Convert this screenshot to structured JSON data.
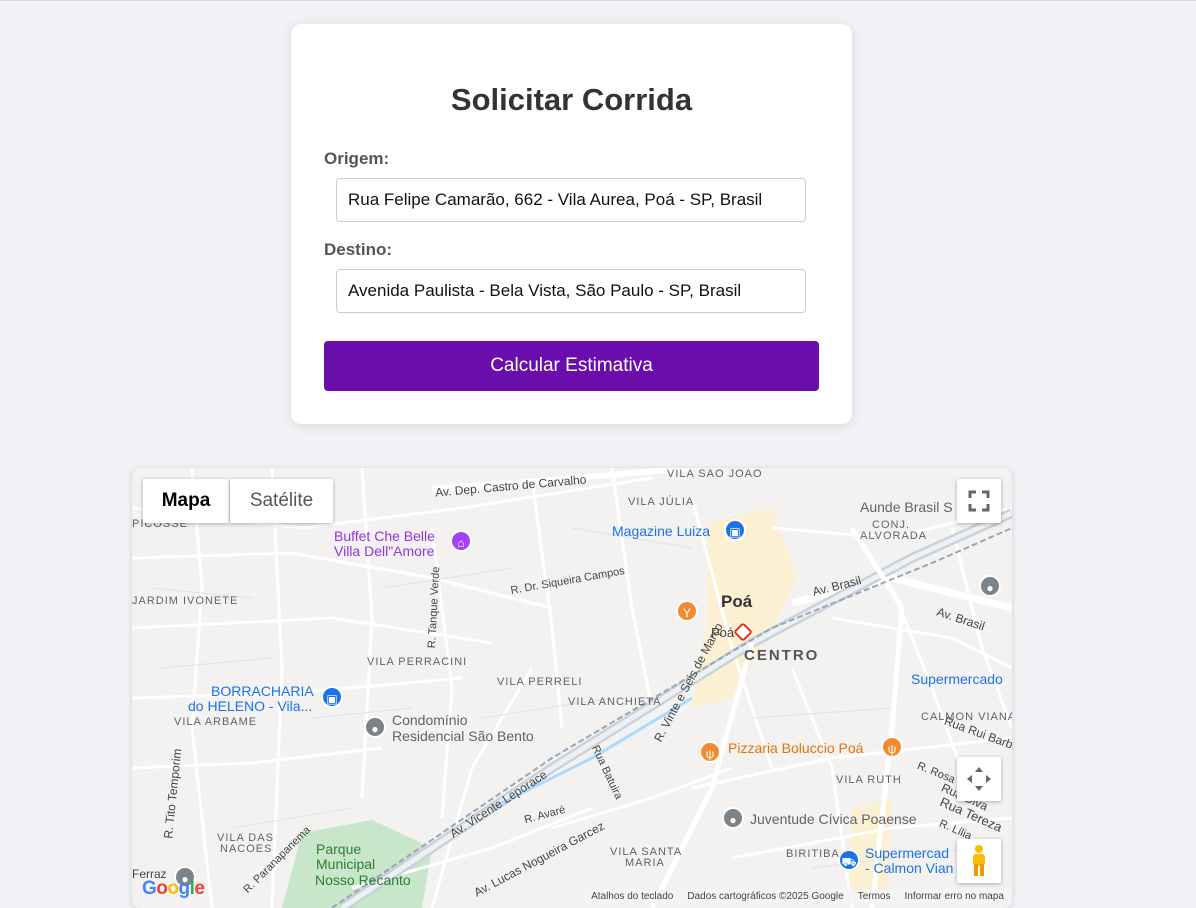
{
  "form": {
    "title": "Solicitar Corrida",
    "origin_label": "Origem:",
    "origin_value": "Rua Felipe Camarão, 662 - Vila Aurea, Poá - SP, Brasil",
    "destination_label": "Destino:",
    "destination_value": "Avenida Paulista - Bela Vista, São Paulo - SP, Brasil",
    "submit_label": "Calcular Estimativa",
    "accent_color": "#6a0dad"
  },
  "map": {
    "map_type_buttons": [
      "Mapa",
      "Satélite"
    ],
    "selected_map_type": "Mapa",
    "fullscreen_icon": "fullscreen-icon",
    "camera_icon": "camera-control-icon",
    "pegman_icon": "pegman-icon",
    "logo": "Google",
    "attribution": {
      "shortcuts": "Atalhos do teclado",
      "data": "Dados cartográficos ©2025 Google",
      "terms": "Termos",
      "report": "Informar erro no mapa"
    },
    "areas": {
      "vila_sao_joao": "VILA SAO JOAO",
      "vila_julia": "VILA JÚLIA",
      "conj_alvorada_1": "CONJ.",
      "conj_alvorada_2": "ALVORADA",
      "jardim_ivonete": "JARDIM IVONETE",
      "vila_perracini": "VILA PERRACINI",
      "vila_perreli": "VILA PERRELI",
      "vila_anchieta": "VILA ANCHIETA",
      "vila_arbame": "VILA ARBAME",
      "calmon_viana": "CALMON VIANA",
      "vila_ruth": "VILA RUTH",
      "vila_das_nacoes_1": "VILA DAS",
      "vila_das_nacoes_2": "NACOES",
      "vila_santa_maria_1": "VILA SANTA",
      "vila_santa_maria_2": "MARIA",
      "biritiba": "BIRITIBA",
      "centro": "CENTRO",
      "poa": "Poá",
      "picosse": "PICOSSE"
    },
    "streets": {
      "castro_carvalho": "Av. Dep. Castro de Carvalho",
      "siqueira_campos": "R. Dr. Siqueira Campos",
      "av_brasil": "Av. Brasil",
      "tanque_verde": "R. Tanque Verde",
      "vicente_leporace": "Av. Vicente Leporace",
      "vinte_seis_marco": "R. Vinte e Seis de Março",
      "batuira": "Rua Batuira",
      "tito_temporim": "R. Tito Temporim",
      "avare": "R. Avaré",
      "lucas_garcez": "Av. Lucas Nogueira Garcez",
      "paranapanema": "R. Paranapanema",
      "rui_barbosa": "Rua Rui Barbosa",
      "rua_diva": "Rua Diva",
      "rua_tereza": "Rua Tereza",
      "r_lilia": "R. Lília",
      "r_rosa": "R. Rosa"
    },
    "places": {
      "buffet_1": "Buffet Che Belle",
      "buffet_2": "Villa Dell\"Amore",
      "magazine_luiza": "Magazine Luiza",
      "aunde": "Aunde Brasil S",
      "poa_station": "Poá",
      "borracharia_1": "BORRACHARIA",
      "borracharia_2": "do HELENO - Vila...",
      "condominio_1": "Condomínio",
      "condominio_2": "Residencial São Bento",
      "supermercado": "Supermercado",
      "pizzaria": "Pizzaria Boluccio Poá",
      "juventude": "Juventude Cívica Poaense",
      "super_calmon_1": "Supermercad",
      "super_calmon_2": "- Calmon Vian",
      "parque_1": "Parque",
      "parque_2": "Municipal",
      "parque_3": "Nosso Recanto",
      "ferraz": "Ferraz"
    }
  }
}
